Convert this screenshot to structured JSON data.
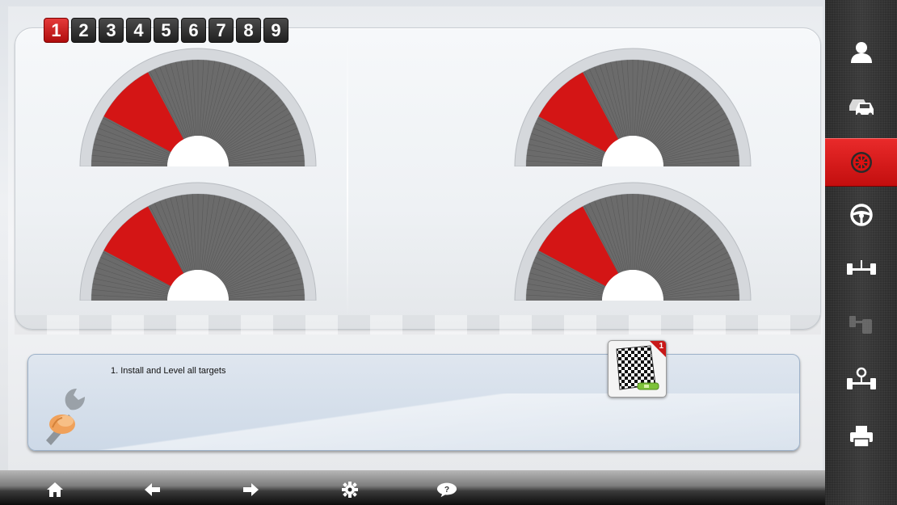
{
  "steps": [
    {
      "label": "1",
      "active": true
    },
    {
      "label": "2",
      "active": false
    },
    {
      "label": "3",
      "active": false
    },
    {
      "label": "4",
      "active": false
    },
    {
      "label": "5",
      "active": false
    },
    {
      "label": "6",
      "active": false
    },
    {
      "label": "7",
      "active": false
    },
    {
      "label": "8",
      "active": false
    },
    {
      "label": "9",
      "active": false
    }
  ],
  "gauges": [
    {
      "position": "front-left",
      "red_segment": "low"
    },
    {
      "position": "front-right",
      "red_segment": "low"
    },
    {
      "position": "rear-left",
      "red_segment": "low"
    },
    {
      "position": "rear-right",
      "red_segment": "low"
    }
  ],
  "info": {
    "instruction": "1. Install and Level all targets",
    "icon": "wrench-hand-icon"
  },
  "target_button": {
    "icon": "checkerboard-target-icon",
    "badge": "1"
  },
  "bottom_nav": [
    {
      "name": "home-icon"
    },
    {
      "name": "back-arrow-icon"
    },
    {
      "name": "forward-arrow-icon"
    },
    {
      "name": "settings-gear-icon"
    },
    {
      "name": "help-icon"
    }
  ],
  "sidebar": [
    {
      "name": "customer-icon",
      "active": false
    },
    {
      "name": "vehicle-icon",
      "active": false
    },
    {
      "name": "wheel-runout-icon",
      "active": true
    },
    {
      "name": "steering-wheel-icon",
      "active": false
    },
    {
      "name": "axle-measurement-icon",
      "active": false
    },
    {
      "name": "lift-icon",
      "active": false,
      "disabled": true
    },
    {
      "name": "adjustment-icon",
      "active": false
    },
    {
      "name": "print-icon",
      "active": false
    }
  ],
  "colors": {
    "accent_red": "#d41515",
    "gauge_gray": "#6b6b6b",
    "sidebar_bg": "#333333"
  }
}
